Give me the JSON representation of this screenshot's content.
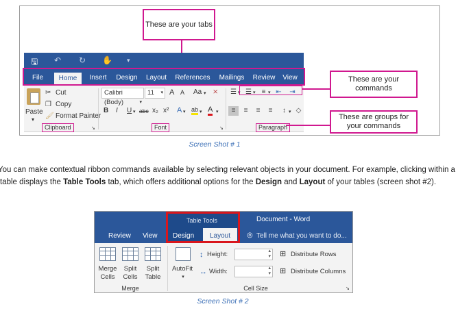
{
  "shot1": {
    "callouts": {
      "tabs": "These are your tabs",
      "commands": "These are your commands",
      "groups": "These are groups for your commands"
    },
    "tabs": [
      "File",
      "Home",
      "Insert",
      "Design",
      "Layout",
      "References",
      "Mailings",
      "Review",
      "View"
    ],
    "active_tab": "Home",
    "clipboard": {
      "paste": "Paste",
      "cut": "Cut",
      "copy": "Copy",
      "format_painter": "Format Painter",
      "group_label": "Clipboard"
    },
    "font": {
      "font_name": "Calibri (Body)",
      "font_size": "11",
      "grow": "A",
      "shrink": "A",
      "case": "Aa",
      "bold": "B",
      "italic": "I",
      "underline": "U",
      "strikethrough": "abc",
      "subscript": "x₂",
      "superscript": "x²",
      "text_effects": "A",
      "highlight": "ab",
      "font_color": "A",
      "group_label": "Font"
    },
    "paragraph": {
      "group_label": "Paragraph"
    },
    "caption": "Screen Shot # 1"
  },
  "paragraph": {
    "p1": "You can make contextual ribbon commands available by selecting relevant objects in your document. For example, clicking within a table displays the ",
    "b1": "Table Tools",
    "p2": " tab, which offers additional options for the ",
    "b2": "Design",
    "p3": " and ",
    "b3": "Layout",
    "p4": " of your tables (screen shot #2)."
  },
  "shot2": {
    "context_title": "Table Tools",
    "window_title": "Document - Word",
    "tabs": [
      "Review",
      "View",
      "Design",
      "Layout"
    ],
    "active_tab": "Layout",
    "tell_me": "Tell me what you want to do...",
    "merge": {
      "merge_cells": [
        "Merge",
        "Cells"
      ],
      "split_cells": [
        "Split",
        "Cells"
      ],
      "split_table": [
        "Split",
        "Table"
      ],
      "group_label": "Merge"
    },
    "cell_size": {
      "autofit": "AutoFit",
      "height_label": "Height:",
      "width_label": "Width:",
      "distribute_rows": "Distribute Rows",
      "distribute_columns": "Distribute Columns",
      "group_label": "Cell Size"
    },
    "caption": "Screen Shot # 2"
  },
  "colors": {
    "word_blue": "#2b579a",
    "callout_magenta": "#d0188f",
    "highlight_red": "#d9161d",
    "caption_blue": "#3b6fb6"
  }
}
